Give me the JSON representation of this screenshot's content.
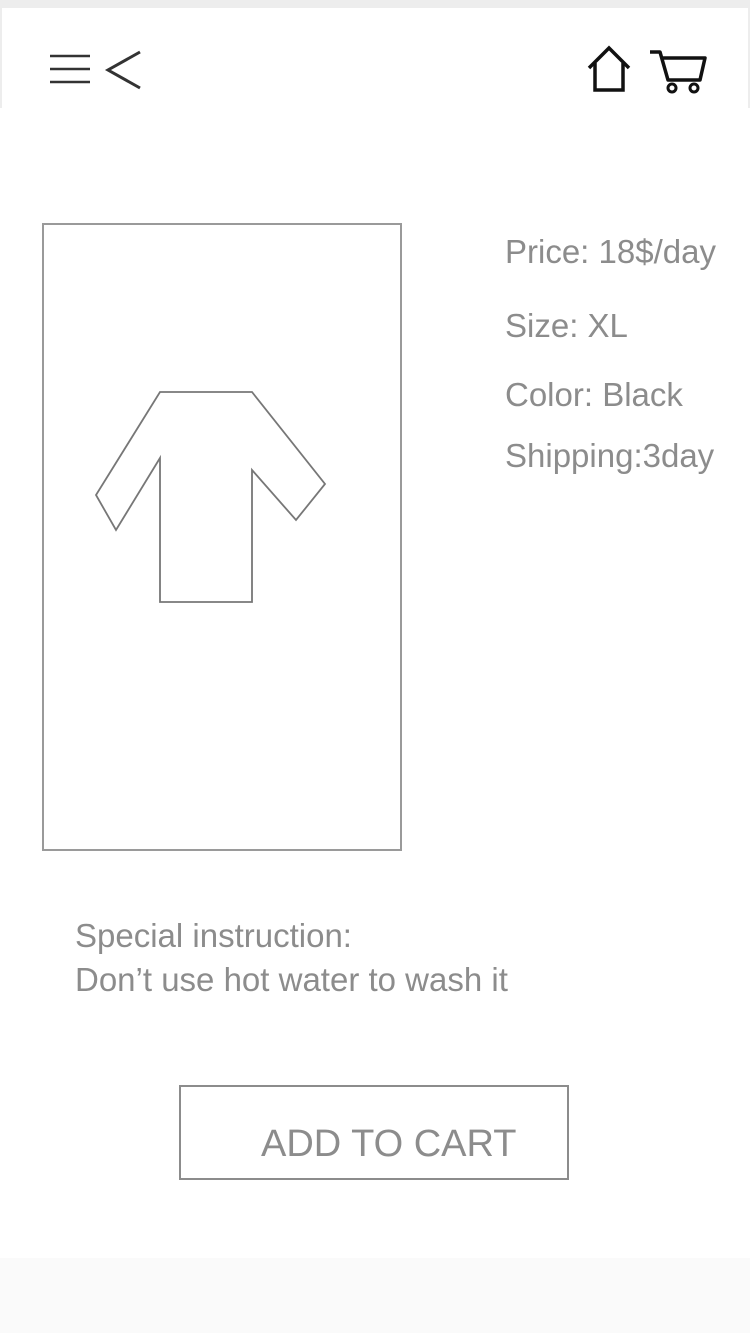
{
  "header": {
    "icons": {
      "menu": "hamburger-menu-icon",
      "back": "chevron-left-icon",
      "home": "home-icon",
      "cart": "shopping-cart-icon"
    }
  },
  "product": {
    "image_icon": "shirt-icon",
    "details": {
      "price": "Price: 18$/day",
      "size": "Size: XL",
      "color": "Color: Black",
      "shipping": "Shipping:3day"
    }
  },
  "instructions": {
    "heading": "Special instruction:",
    "text": "Don’t use hot water to wash it"
  },
  "actions": {
    "add_to_cart_label": "ADD TO CART"
  },
  "colors": {
    "text": "#8c8c8c",
    "border": "#9a9a9a",
    "icon": "#222222"
  }
}
